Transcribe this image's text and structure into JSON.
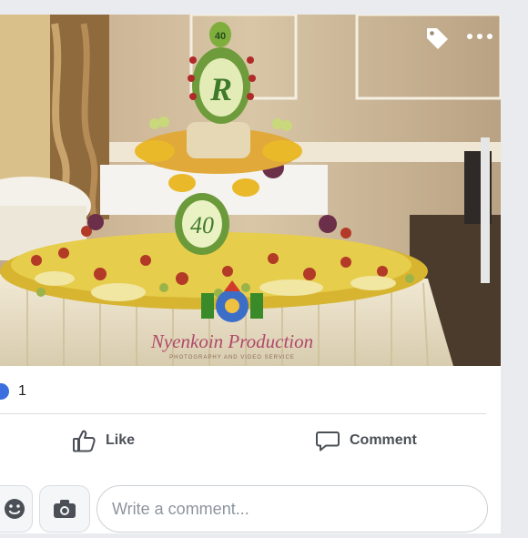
{
  "post": {
    "watermark_text": "Nyenkoin Production",
    "watermark_subtext": "PHOTOGRAPHY AND VIDEO SERVICE",
    "icons": {
      "tag": "tag-icon",
      "more": "more-options-icon"
    }
  },
  "reactions": {
    "count": "1",
    "icon": "like-reaction-icon"
  },
  "actions": {
    "like_label": "Like",
    "comment_label": "Comment"
  },
  "composer": {
    "placeholder": "Write a comment...",
    "emoji_icon": "emoji-icon",
    "camera_icon": "camera-icon"
  },
  "colors": {
    "accent": "#3b6fe0",
    "text": "#1c1e21",
    "muted": "#4b4f56"
  }
}
